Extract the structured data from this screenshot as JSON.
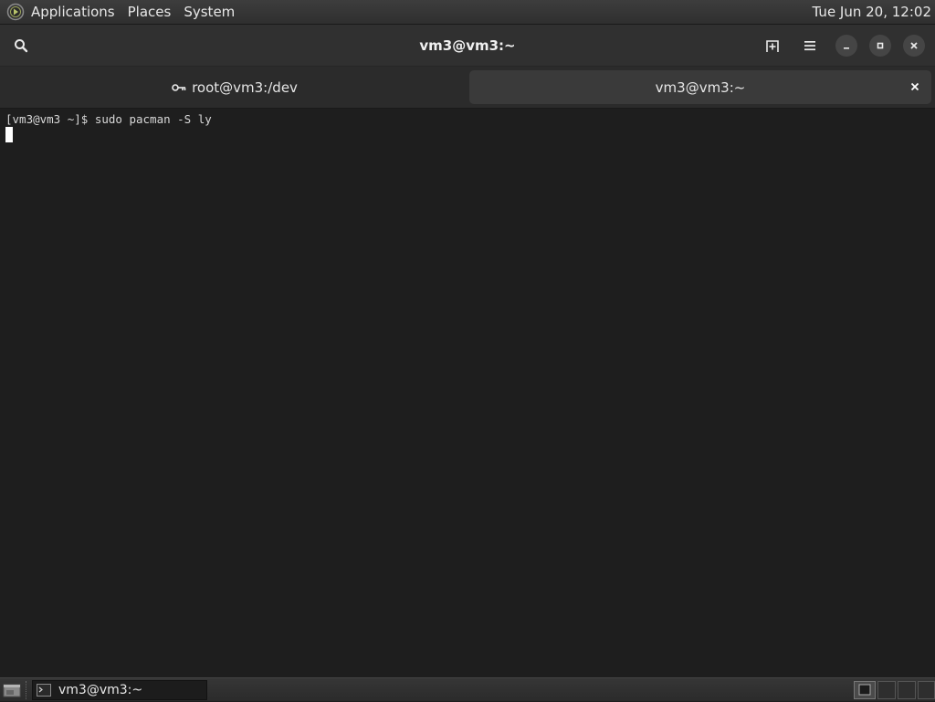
{
  "top_panel": {
    "menus": [
      "Applications",
      "Places",
      "System"
    ],
    "clock": "Tue Jun 20, 12:02"
  },
  "window": {
    "title": "vm3@vm3:~",
    "tabs": [
      {
        "label": "root@vm3:/dev",
        "icon": "key-icon",
        "active": false
      },
      {
        "label": "vm3@vm3:~",
        "icon": "",
        "active": true
      }
    ]
  },
  "terminal": {
    "prompt": "[vm3@vm3 ~]$ ",
    "command": "sudo pacman -S ly"
  },
  "taskbar": {
    "items": [
      {
        "label": "vm3@vm3:~",
        "icon": "terminal-icon"
      }
    ],
    "workspaces": 4
  },
  "colors": {
    "terminal_bg": "#1e1e1e",
    "headerbar_bg": "#303030",
    "tab_active_bg": "#3a3a3a"
  }
}
